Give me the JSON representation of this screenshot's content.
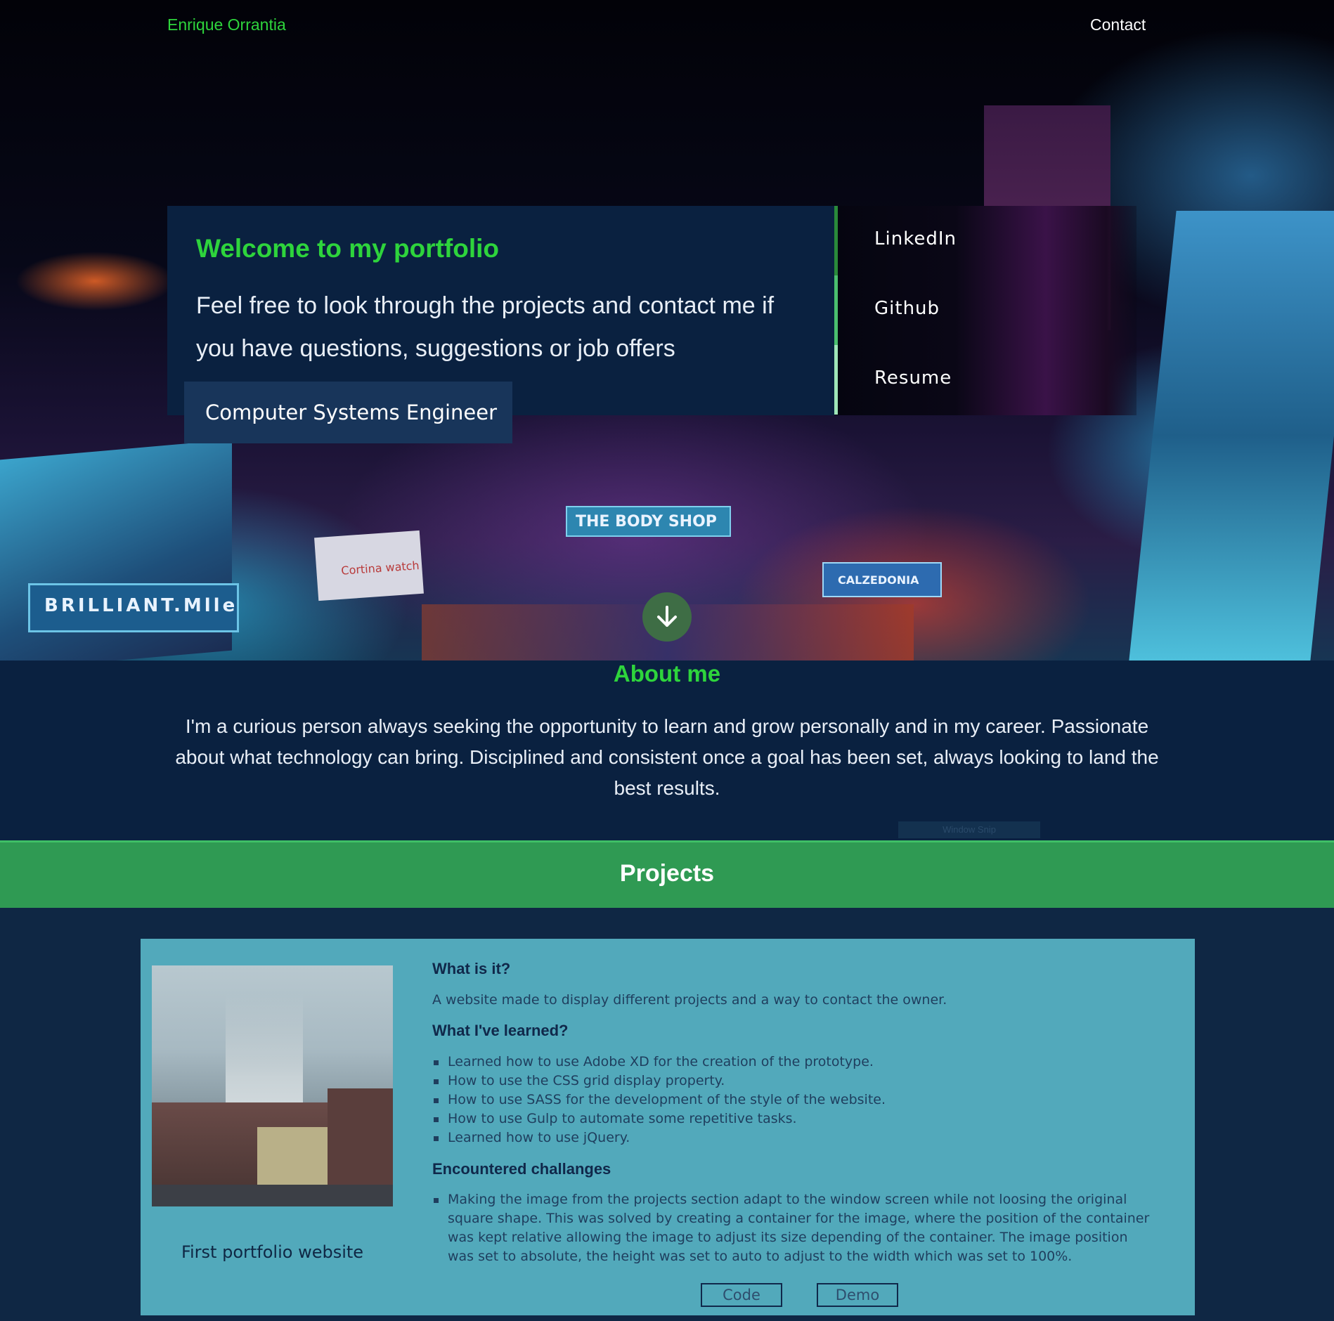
{
  "header": {
    "logo": "Enrique Orrantia",
    "contact_label": "Contact"
  },
  "hero": {
    "welcome_title": "Welcome to my portfolio",
    "welcome_text": "Feel free to look through the projects and contact me if you have questions, suggestions or job offers",
    "subtitle": "Computer Systems Engineer",
    "links": [
      {
        "label": "LinkedIn"
      },
      {
        "label": "Github"
      },
      {
        "label": "Resume"
      }
    ],
    "scroll_icon": "arrow-down-icon",
    "signs": [
      "THE BODY SHOP",
      "CALZEDONIA",
      "BRILLIANT.Mlle",
      "Cortina watch"
    ]
  },
  "about": {
    "title": "About me",
    "text": "I'm a curious person always seeking the opportunity to learn and grow personally and in my career. Passionate about what technology can bring. Disciplined and consistent once a goal has been set, always looking to land the best results."
  },
  "overlay": {
    "snip_label": "Window Snip"
  },
  "projects": {
    "title": "Projects",
    "items": [
      {
        "name": "First portfolio website",
        "what_heading": "What is it?",
        "what_text": "A website made to display different projects and a way to contact the owner.",
        "learned_heading": "What I've learned?",
        "learned": [
          "Learned how to use Adobe XD for the creation of the prototype.",
          "How to use the CSS grid display property.",
          "How to use SASS for the development of the style of the website.",
          "How to use Gulp to automate some repetitive tasks.",
          "Learned how to use jQuery."
        ],
        "challenges_heading": "Encountered challanges",
        "challenges": [
          "Making the image from the projects section adapt to the window screen while not loosing the original square shape. This was solved by creating a container for the image, where the position of the container was kept relative allowing the image to adjust its size depending of the container. The image position was set to absolute, the height was set to auto to adjust to the width which was set to 100%."
        ],
        "code_label": "Code",
        "demo_label": "Demo"
      }
    ]
  },
  "colors": {
    "accent_green": "#2ed43c",
    "navy": "#0a2140",
    "projects_bar": "#2f9a53",
    "card": "#52a9bb",
    "side_bar_segments": [
      "#2a8a3a",
      "#4bbf6e",
      "#9fe6b8"
    ]
  }
}
